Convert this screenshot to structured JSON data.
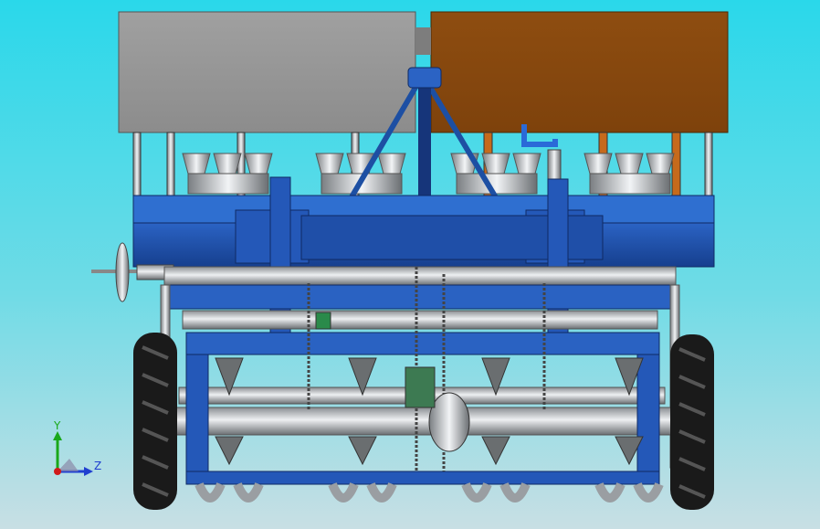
{
  "viewport": {
    "background_top": "#2ad8ea",
    "background_bottom": "#c8dfe4"
  },
  "model": {
    "seed_box_left_color": "#9a9a9a",
    "seed_box_right_color": "#8b4a0e",
    "frame_color": "#1f4fa8",
    "frame_dark_color": "#143a80",
    "steel_color": "#c8ccd0",
    "tire_color": "#1a1a1a"
  },
  "triad": {
    "y_label": "Y",
    "z_label": "Z",
    "y_color": "#1aa81a",
    "z_color": "#1f3fd0",
    "origin_color": "#d01a1a"
  }
}
